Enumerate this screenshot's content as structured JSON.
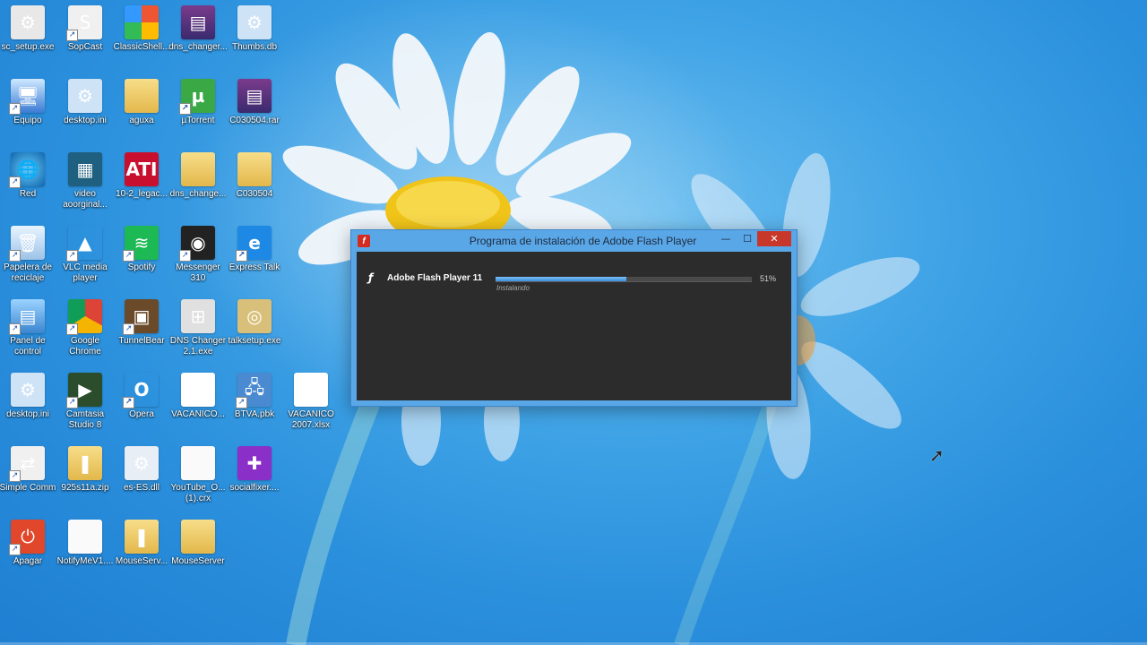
{
  "desktop_icons": [
    {
      "label": "sc_setup.exe",
      "icon": "exe-icon",
      "glyph": "⚙"
    },
    {
      "label": "SopCast",
      "icon": "sopcast-icon",
      "glyph": "S"
    },
    {
      "label": "ClassicShell...",
      "icon": "classic-shell-icon",
      "glyph": ""
    },
    {
      "label": "dns_changer...",
      "icon": "winrar-icon",
      "glyph": "▤"
    },
    {
      "label": "Thumbs.db",
      "icon": "gear-file-icon",
      "glyph": "⚙"
    },
    {
      "label": "Equipo",
      "icon": "computer-icon",
      "glyph": "🖥"
    },
    {
      "label": "desktop.ini",
      "icon": "gear-file-icon",
      "glyph": "⚙"
    },
    {
      "label": "aguxa",
      "icon": "folder-icon",
      "glyph": ""
    },
    {
      "label": "µTorrent",
      "icon": "utorrent-icon",
      "glyph": "µ"
    },
    {
      "label": "C030504.rar",
      "icon": "winrar-icon",
      "glyph": "▤"
    },
    {
      "label": "Red",
      "icon": "network-globe-icon",
      "glyph": "🌐"
    },
    {
      "label": "video aoorginal...",
      "icon": "video-file-icon",
      "glyph": "▦"
    },
    {
      "label": "10-2_legac...",
      "icon": "ati-icon",
      "glyph": "ATI"
    },
    {
      "label": "dns_change...",
      "icon": "folder-icon",
      "glyph": ""
    },
    {
      "label": "C030504",
      "icon": "folder-icon",
      "glyph": ""
    },
    {
      "label": "Papelera de reciclaje",
      "icon": "recycle-bin-icon",
      "glyph": "🗑"
    },
    {
      "label": "VLC media player",
      "icon": "vlc-icon",
      "glyph": "▲"
    },
    {
      "label": "Spotify",
      "icon": "spotify-icon",
      "glyph": "≋"
    },
    {
      "label": "Messenger 310",
      "icon": "camera-icon",
      "glyph": "◉"
    },
    {
      "label": "Express Talk",
      "icon": "express-talk-icon",
      "glyph": "e"
    },
    {
      "label": "Panel de control",
      "icon": "control-panel-icon",
      "glyph": "▤"
    },
    {
      "label": "Google Chrome",
      "icon": "chrome-icon",
      "glyph": ""
    },
    {
      "label": "TunnelBear",
      "icon": "tunnelbear-icon",
      "glyph": "▣"
    },
    {
      "label": "DNS Changer 2.1.exe",
      "icon": "windows-app-icon",
      "glyph": "⊞"
    },
    {
      "label": "talksetup.exe",
      "icon": "setup-disc-icon",
      "glyph": "◎"
    },
    {
      "label": "desktop.ini",
      "icon": "gear-file-icon",
      "glyph": "⚙"
    },
    {
      "label": "Camtasia Studio 8",
      "icon": "camtasia-icon",
      "glyph": "▶"
    },
    {
      "label": "Opera",
      "icon": "opera-icon",
      "glyph": "O"
    },
    {
      "label": "VACANICO...",
      "icon": "excel-icon",
      "glyph": "X"
    },
    {
      "label": "BTVA.pbk",
      "icon": "network-connection-icon",
      "glyph": "🖧"
    },
    {
      "label": "VACANICO 2007.xlsx",
      "icon": "excel-icon",
      "glyph": "X"
    },
    {
      "label": "Simple Comm",
      "icon": "simple-comm-icon",
      "glyph": "⇄"
    },
    {
      "label": "925s11a.zip",
      "icon": "zip-folder-icon",
      "glyph": "❚"
    },
    {
      "label": "es-ES.dll",
      "icon": "dll-gear-icon",
      "glyph": "⚙"
    },
    {
      "label": "YouTube_O... (1).crx",
      "icon": "blank-file-icon",
      "glyph": ""
    },
    {
      "label": "socialfixer....",
      "icon": "puzzle-icon",
      "glyph": "✚"
    },
    {
      "label": "Apagar",
      "icon": "power-icon",
      "glyph": "⏻"
    },
    {
      "label": "NotifyMeV1....",
      "icon": "blank-file-icon",
      "glyph": ""
    },
    {
      "label": "MouseServ...",
      "icon": "zip-folder-icon",
      "glyph": "❚"
    },
    {
      "label": "MouseServer",
      "icon": "folder-icon",
      "glyph": ""
    }
  ],
  "installer": {
    "title": "Programa de instalación de Adobe Flash Player",
    "app_icon_glyph": "f",
    "minimize_glyph": "—",
    "maximize_glyph": "☐",
    "close_glyph": "✕",
    "product_icon_glyph": "ƒ",
    "product_name": "Adobe Flash Player 11",
    "status": "Instalando",
    "progress_percent": 51,
    "progress_label": "51%"
  },
  "cursor_glyph": "➚"
}
